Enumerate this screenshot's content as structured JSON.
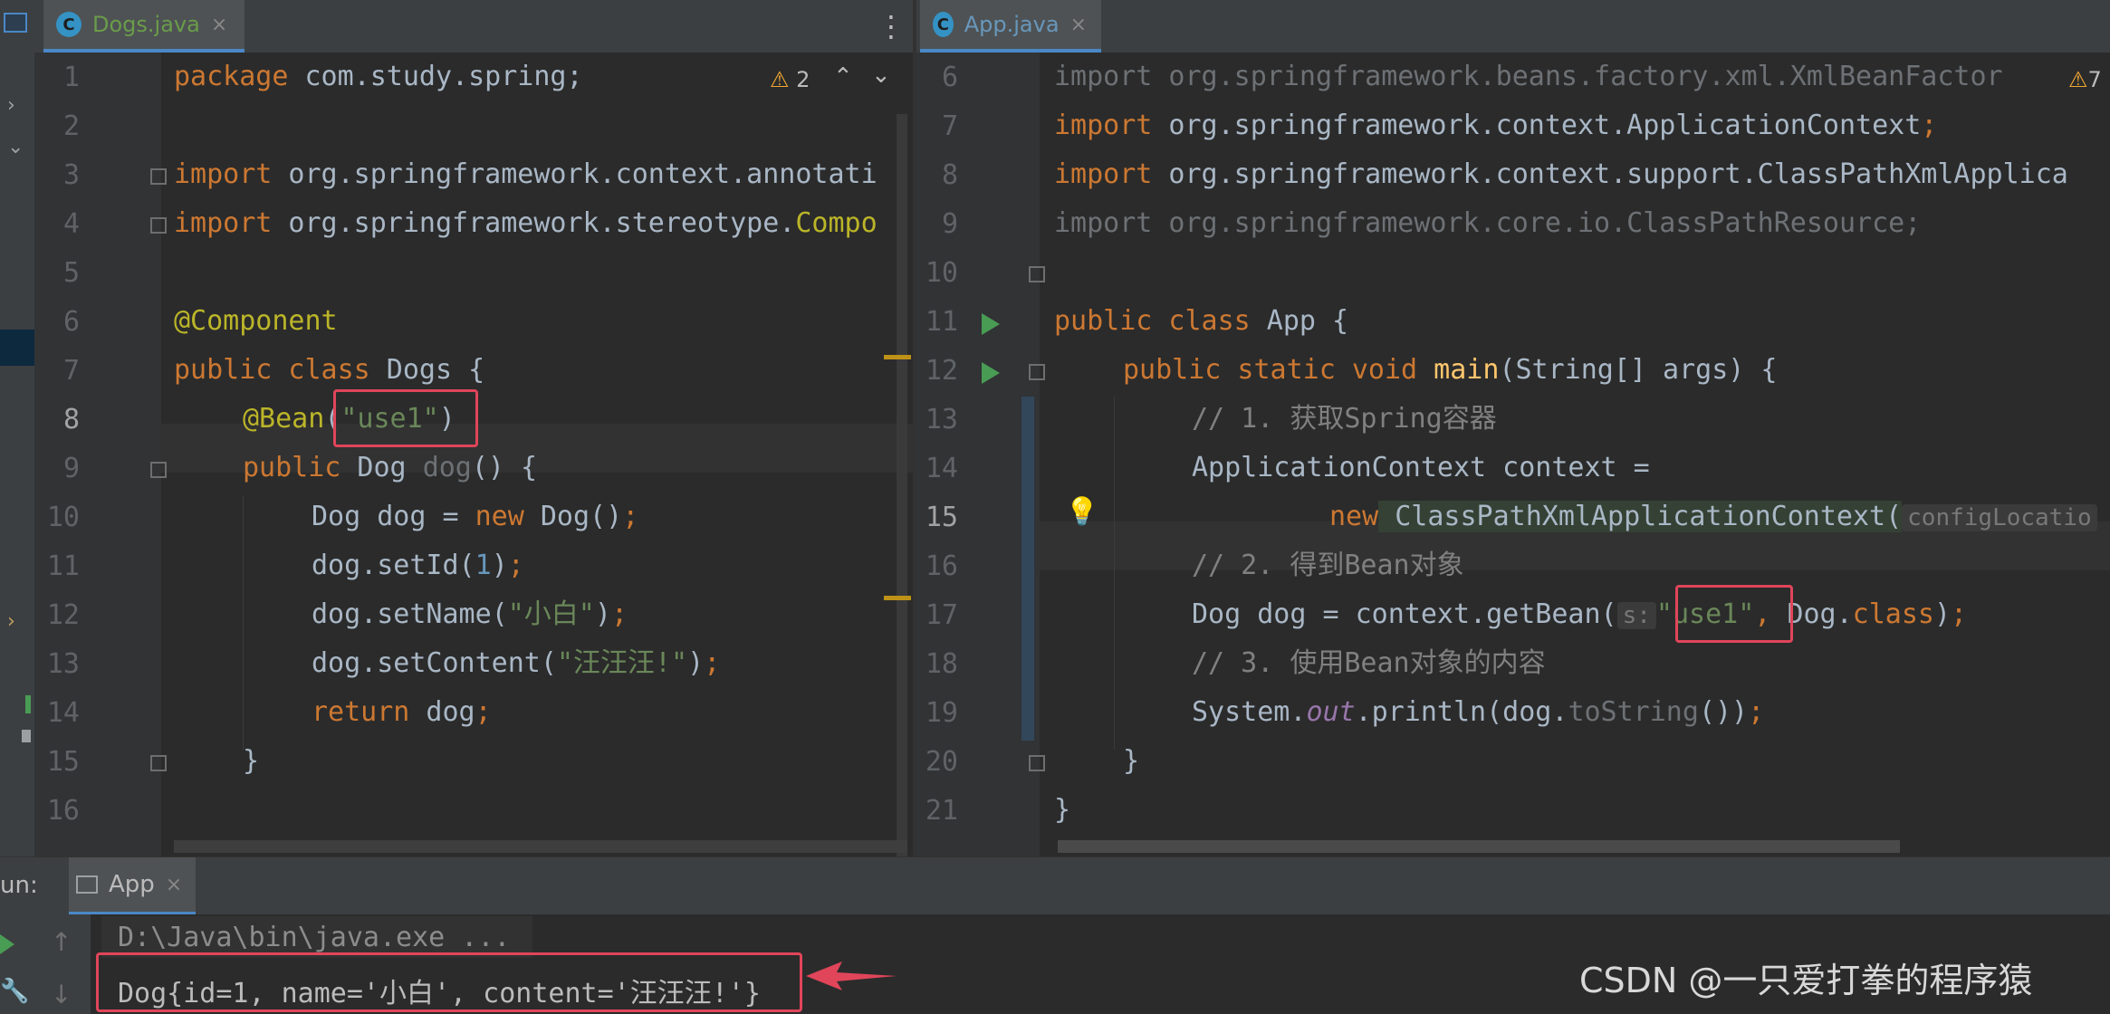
{
  "left_tab": {
    "icon": "C",
    "label": "Dogs.java",
    "close": "×"
  },
  "right_tab": {
    "icon": "C",
    "label": "App.java",
    "close": "×"
  },
  "menu_glyph": "⋮",
  "left_editor": {
    "warnings": "2",
    "line_numbers": [
      "1",
      "2",
      "3",
      "4",
      "5",
      "6",
      "7",
      "8",
      "9",
      "10",
      "11",
      "12",
      "13",
      "14",
      "15",
      "16"
    ],
    "lines": {
      "l1a": "package",
      "l1b": " com.study.spring;",
      "l3a": "import",
      "l3b": " org.springframework.context.annotati",
      "l4a": "import",
      "l4b": " org.springframework.stereotype.",
      "l4c": "Compo",
      "l6": "@Component",
      "l7a": "public class",
      "l7b": " Dogs {",
      "l8a": "@Bean",
      "l8b": "(",
      "l8c": "\"use1\"",
      "l8d": ")",
      "l9a": "public",
      "l9b": " Dog ",
      "l9c": "dog",
      "l9d": "() {",
      "l10a": "Dog dog = ",
      "l10b": "new",
      "l10c": " Dog()",
      "l10d": ";",
      "l11a": "dog.setId(",
      "l11b": "1",
      "l11c": ")",
      "l11d": ";",
      "l12a": "dog.setName(",
      "l12b": "\"小白\"",
      "l12c": ")",
      "l12d": ";",
      "l13a": "dog.setContent(",
      "l13b": "\"汪汪汪!\"",
      "l13c": ")",
      "l13d": ";",
      "l14a": "return",
      "l14b": " dog",
      "l14c": ";",
      "l15": "}"
    }
  },
  "right_editor": {
    "warnings": "7",
    "line_numbers": [
      "6",
      "7",
      "8",
      "9",
      "10",
      "11",
      "12",
      "13",
      "14",
      "15",
      "16",
      "17",
      "18",
      "19",
      "20",
      "21"
    ],
    "lines": {
      "l6a": "import",
      "l6b": " org.springframework.beans.factory.xml.XmlBeanFactor",
      "l7a": "import",
      "l7b": " org.springframework.context.ApplicationContext",
      "l7c": ";",
      "l8a": "import",
      "l8b": " org.springframework.context.support.ClassPathXmlApplica",
      "l9a": "import",
      "l9b": " org.springframework.core.io.ClassPathResource;",
      "l11a": "public class",
      "l11b": " App {",
      "l12a": "public static void",
      "l12b": " main",
      "l12c": "(String[] args) {",
      "l13": "// 1. 获取Spring容器",
      "l14": "ApplicationContext context =",
      "l15a": "new",
      "l15b": " ClassPathXmlApplicationContext(",
      "l15c": "configLocatio",
      "l16": "// 2. 得到Bean对象",
      "l17a": "Dog dog = context.getBean(",
      "l17b": "s:",
      "l17c": "\"use1\"",
      "l17d": ",",
      "l17e": " Dog.",
      "l17f": "class",
      "l17g": ")",
      "l17h": ";",
      "l18": "// 3. 使用Bean对象的内容",
      "l19a": "System.",
      "l19b": "out",
      "l19c": ".println(dog.",
      "l19d": "toString",
      "l19e": "())",
      "l19f": ";",
      "l20": "}",
      "l21": "}"
    }
  },
  "run_panel": {
    "label": "un:",
    "tab": "App",
    "tab_close": "×",
    "command": "D:\\Java\\bin\\java.exe ...",
    "output": "Dog{id=1, name='小白', content='汪汪汪!'}"
  },
  "watermark": "CSDN @一只爱打拳的程序猿",
  "colors": {
    "keyword": "#cc7832",
    "string": "#6a8759",
    "annotation": "#bbb529",
    "highlight_box": "#e0455a"
  }
}
